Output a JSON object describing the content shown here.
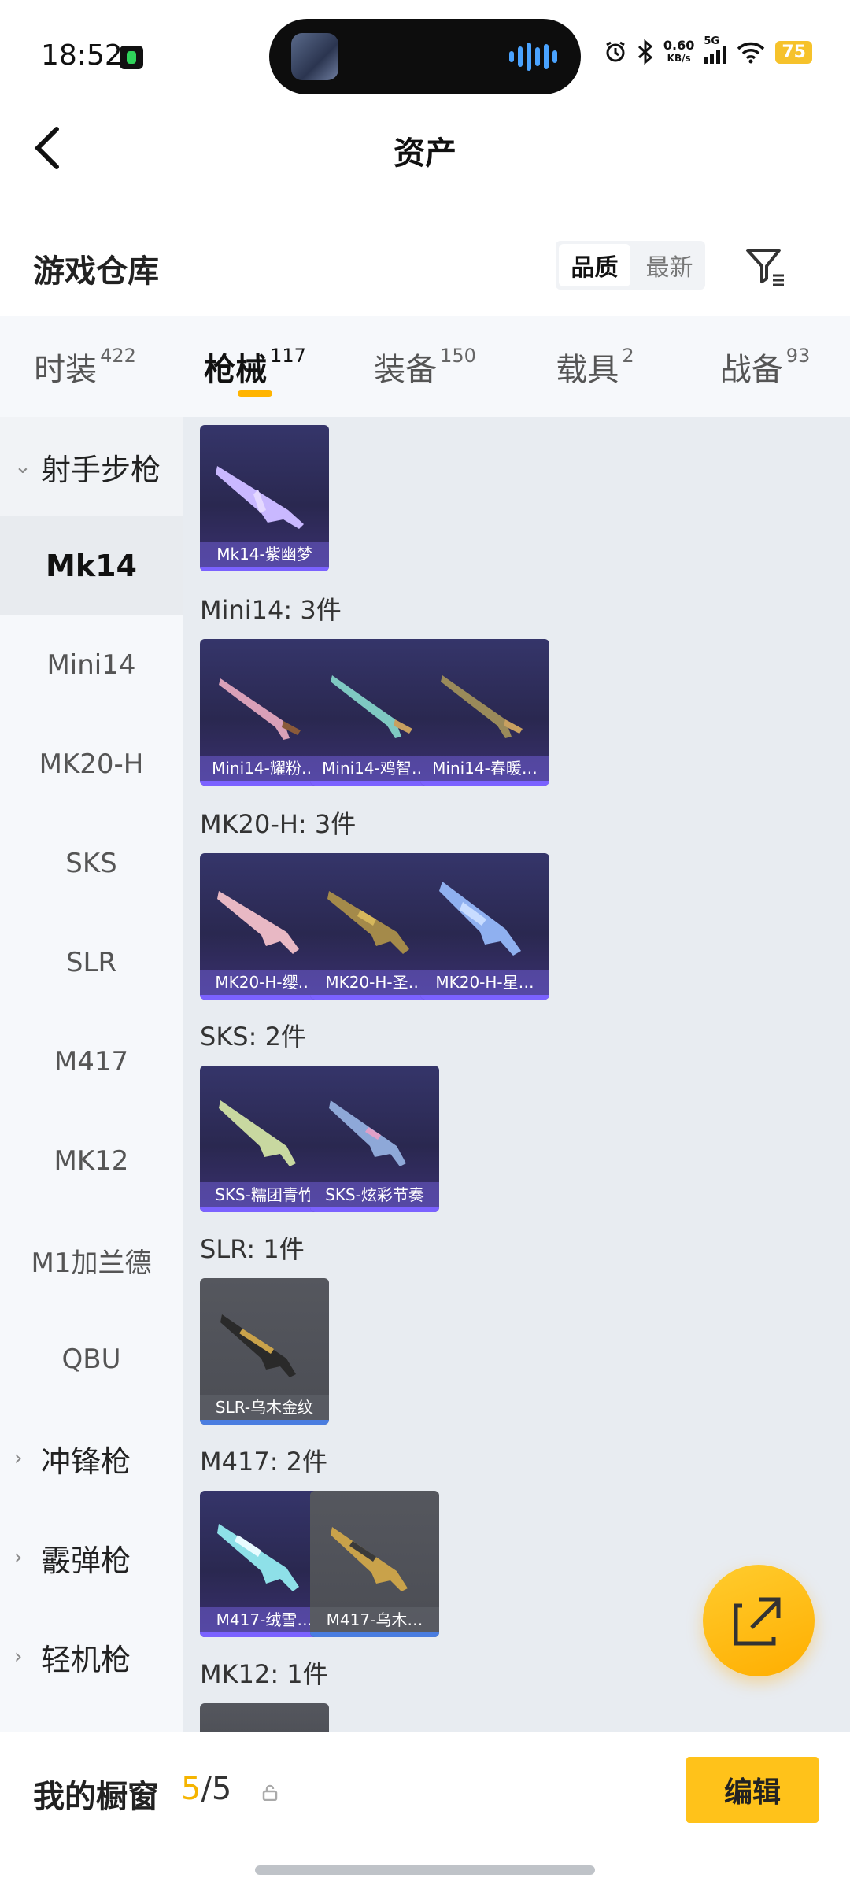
{
  "status_bar": {
    "time": "18:52",
    "net_speed_value": "0.60",
    "net_speed_unit": "KB/s",
    "network": "5G",
    "battery": "75"
  },
  "header": {
    "title": "资产"
  },
  "warehouse": {
    "title": "游戏仓库",
    "sort_quality": "品质",
    "sort_latest": "最新"
  },
  "tabs": [
    {
      "label": "时装",
      "count": "422"
    },
    {
      "label": "枪械",
      "count": "117"
    },
    {
      "label": "装备",
      "count": "150"
    },
    {
      "label": "载具",
      "count": "2"
    },
    {
      "label": "战备",
      "count": "93"
    }
  ],
  "sidebar": {
    "group_marksman": "射手步枪",
    "items": [
      "Mk14",
      "Mini14",
      "MK20-H",
      "SKS",
      "SLR",
      "M417",
      "MK12",
      "M1加兰德",
      "QBU"
    ],
    "group_smg": "冲锋枪",
    "group_shotgun": "霰弹枪",
    "group_lmg": "轻机枪"
  },
  "sections": {
    "mini14": "Mini14: 3件",
    "mk20h": "MK20-H: 3件",
    "sks": "SKS: 2件",
    "slr": "SLR: 1件",
    "m417": "M417: 2件",
    "mk12": "MK12: 1件"
  },
  "cards": {
    "mk14_1": "Mk14-紫幽梦",
    "mini14_1": "Mini14-耀粉…",
    "mini14_2": "Mini14-鸡智…",
    "mini14_3": "Mini14-春暖…",
    "mk20h_1": "MK20-H-缨…",
    "mk20h_2": "MK20-H-圣…",
    "mk20h_3": "MK20-H-星…",
    "sks_1": "SKS-糯团青竹",
    "sks_2": "SKS-炫彩节奏",
    "slr_1": "SLR-乌木金纹",
    "m417_1": "M417-绒雪…",
    "m417_2": "M417-乌木…"
  },
  "bottom": {
    "my_window": "我的橱窗",
    "count_current": "5",
    "count_total": "/5",
    "edit": "编辑"
  },
  "colors": {
    "accent": "#FFC21A",
    "tab_underline": "#FFB400",
    "card_purple": "#2A2850",
    "card_grey": "#4B4D54"
  }
}
